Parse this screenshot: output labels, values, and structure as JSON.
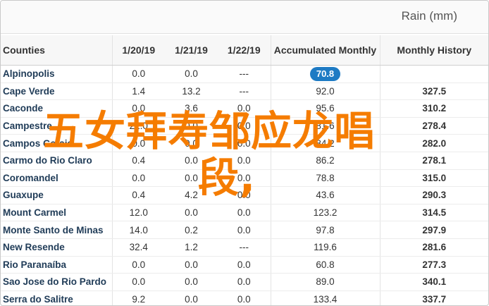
{
  "header": {
    "unit_label": "Rain (mm)"
  },
  "columns": {
    "name": "Counties",
    "d1": "1/20/19",
    "d2": "1/21/19",
    "d3": "1/22/19",
    "acc": "Accumulated Monthly",
    "hist": "Monthly History"
  },
  "rows": [
    {
      "name": "Alpinopolis",
      "d1": "0.0",
      "d2": "0.0",
      "d3": "---",
      "acc": "70.8",
      "hist": ""
    },
    {
      "name": "Cape Verde",
      "d1": "1.4",
      "d2": "13.2",
      "d3": "---",
      "acc": "92.0",
      "hist": "327.5"
    },
    {
      "name": "Caconde",
      "d1": "0.0",
      "d2": "3.6",
      "d3": "0.0",
      "acc": "95.6",
      "hist": "310.2"
    },
    {
      "name": "Campestre",
      "d1": "22.0",
      "d2": "0.0",
      "d3": "0.0",
      "acc": "81.6",
      "hist": "278.4"
    },
    {
      "name": "Campos Gerais",
      "d1": "0.0",
      "d2": "0.0",
      "d3": "0.0",
      "acc": "84.2",
      "hist": "282.0"
    },
    {
      "name": "Carmo do Rio Claro",
      "d1": "0.4",
      "d2": "0.0",
      "d3": "0.0",
      "acc": "86.2",
      "hist": "278.1"
    },
    {
      "name": "Coromandel",
      "d1": "0.0",
      "d2": "0.0",
      "d3": "0.0",
      "acc": "78.8",
      "hist": "315.0"
    },
    {
      "name": "Guaxupe",
      "d1": "0.4",
      "d2": "4.2",
      "d3": "0.0",
      "acc": "43.6",
      "hist": "290.3"
    },
    {
      "name": "Mount Carmel",
      "d1": "12.0",
      "d2": "0.0",
      "d3": "0.0",
      "acc": "123.2",
      "hist": "314.5"
    },
    {
      "name": "Monte Santo de Minas",
      "d1": "14.0",
      "d2": "0.2",
      "d3": "0.0",
      "acc": "97.8",
      "hist": "297.9"
    },
    {
      "name": "New Resende",
      "d1": "32.4",
      "d2": "1.2",
      "d3": "---",
      "acc": "119.6",
      "hist": "281.6"
    },
    {
      "name": "Rio Paranaíba",
      "d1": "0.0",
      "d2": "0.0",
      "d3": "0.0",
      "acc": "60.8",
      "hist": "277.3"
    },
    {
      "name": "Sao Jose do Rio Pardo",
      "d1": "0.0",
      "d2": "0.0",
      "d3": "0.0",
      "acc": "89.0",
      "hist": "340.1"
    },
    {
      "name": "Serra do Salitre",
      "d1": "9.2",
      "d2": "0.0",
      "d3": "0.0",
      "acc": "133.4",
      "hist": "337.7"
    }
  ],
  "highlight": {
    "row_index": 0,
    "color": "#1e7bc4"
  },
  "overlay": {
    "line1": "五女拜寿邹应龙唱",
    "line2": "段,",
    "color": "#f57c00"
  }
}
